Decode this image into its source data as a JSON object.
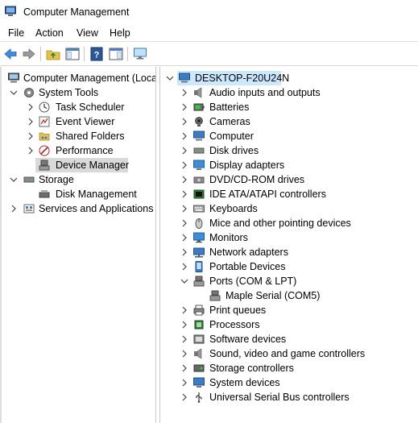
{
  "window": {
    "title": "Computer Management"
  },
  "menu": {
    "items": [
      "File",
      "Action",
      "View",
      "Help"
    ]
  },
  "left_tree": {
    "root": "Computer Management (Local",
    "system_tools": "System Tools",
    "task_scheduler": "Task Scheduler",
    "event_viewer": "Event Viewer",
    "shared_folders": "Shared Folders",
    "performance": "Performance",
    "device_manager": "Device Manager",
    "storage": "Storage",
    "disk_management": "Disk Management",
    "services": "Services and Applications"
  },
  "device_tree": {
    "root": "DESKTOP-F20U24N",
    "categories": [
      "Audio inputs and outputs",
      "Batteries",
      "Cameras",
      "Computer",
      "Disk drives",
      "Display adapters",
      "DVD/CD-ROM drives",
      "IDE ATA/ATAPI controllers",
      "Keyboards",
      "Mice and other pointing devices",
      "Monitors",
      "Network adapters",
      "Portable Devices",
      "Ports (COM & LPT)",
      "Print queues",
      "Processors",
      "Software devices",
      "Sound, video and game controllers",
      "Storage controllers",
      "System devices",
      "Universal Serial Bus controllers"
    ],
    "ports_child": "Maple Serial (COM5)"
  },
  "colors": {
    "selection": "#cce8ff",
    "accent": "#1a6fc4"
  }
}
